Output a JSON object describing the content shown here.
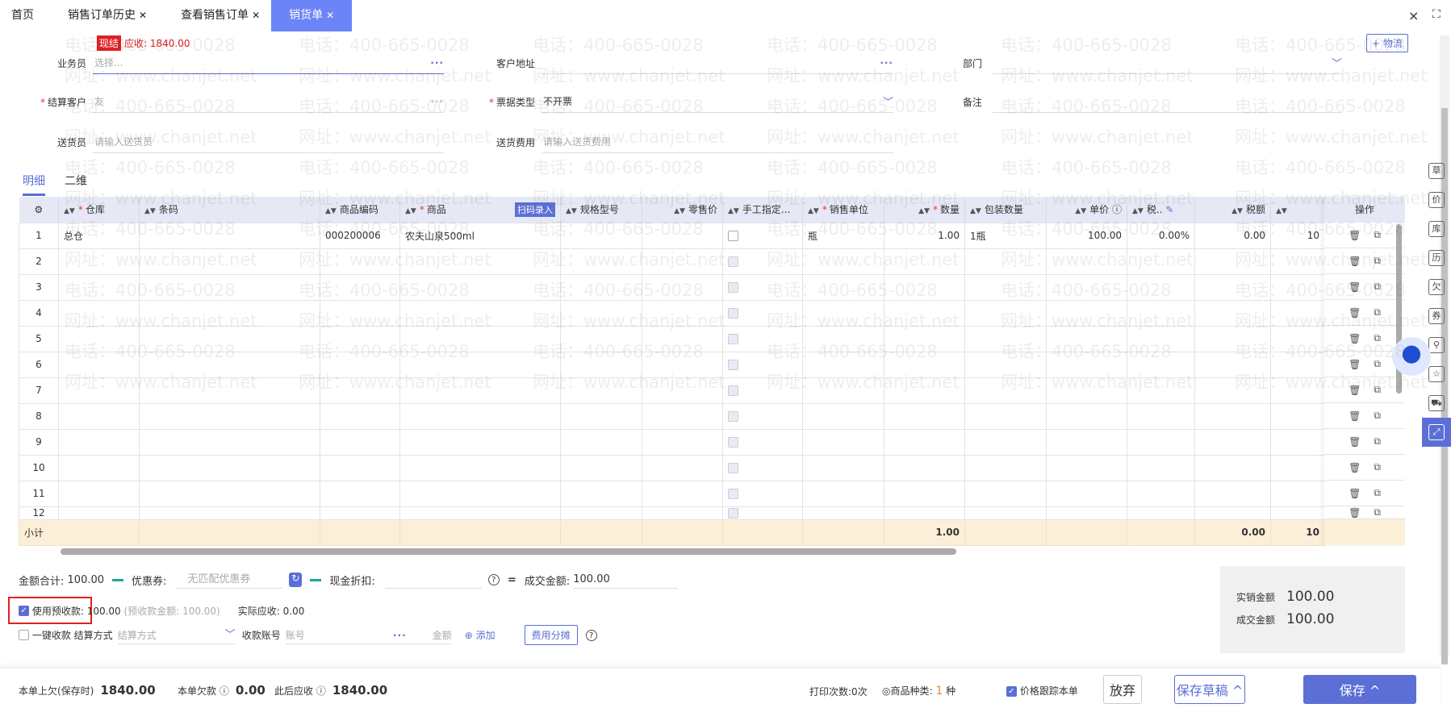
{
  "watermark": {
    "phone": "电话：400-665-0028",
    "site": "网址：www.chanjet.net"
  },
  "tabs": [
    {
      "label": "首页",
      "closable": false
    },
    {
      "label": "销售订单历史",
      "closable": true
    },
    {
      "label": "查看销售订单",
      "closable": true
    },
    {
      "label": "销货单",
      "closable": true,
      "active": true
    }
  ],
  "close_x": "×",
  "header": {
    "badge": "现结",
    "receivable": "应收: 1840.00",
    "logistics_button": "+ 物流",
    "fields": {
      "salesman": {
        "label": "业务员",
        "placeholder": "选择..."
      },
      "customer_address": {
        "label": "客户地址"
      },
      "department": {
        "label": "部门"
      },
      "settle_customer": {
        "label": "结算客户",
        "value": "友"
      },
      "invoice_type": {
        "label": "票据类型",
        "value": "不开票"
      },
      "remark": {
        "label": "备注"
      },
      "deliverer": {
        "label": "送货员",
        "placeholder": "请输入送货员"
      },
      "delivery_fee": {
        "label": "送货费用",
        "placeholder": "请输入送货费用"
      }
    }
  },
  "subtabs": [
    "明细",
    "二维"
  ],
  "table": {
    "columns": [
      "仓库",
      "条码",
      "商品编码",
      "商品",
      "规格型号",
      "零售价",
      "手工指定...",
      "销售单位",
      "数量",
      "包装数量",
      "单价",
      "税..",
      "税额",
      ""
    ],
    "scan_label": "扫码录入",
    "ops_header": "操作",
    "rows": [
      {
        "no": "1",
        "warehouse": "总仓",
        "barcode": "",
        "code": "000200006",
        "product": "农夫山泉500ml",
        "spec": "",
        "retail": "",
        "unit": "瓶",
        "qty": "1.00",
        "pack": "1瓶",
        "price": "100.00",
        "tax_rate": "0.00%",
        "tax": "0.00",
        "amount": "10"
      },
      {
        "no": "2"
      },
      {
        "no": "3"
      },
      {
        "no": "4"
      },
      {
        "no": "5"
      },
      {
        "no": "6"
      },
      {
        "no": "7"
      },
      {
        "no": "8"
      },
      {
        "no": "9"
      },
      {
        "no": "10"
      },
      {
        "no": "11"
      },
      {
        "no": "12"
      }
    ],
    "subtotal": {
      "label": "小计",
      "qty": "1.00",
      "tax": "0.00",
      "amount": "10"
    }
  },
  "summary": {
    "total_label": "金额合计:",
    "total": "100.00",
    "coupon_label": "优惠券:",
    "coupon_value": "无匹配优惠券",
    "cash_discount_label": "现金折扣:",
    "deal_label": "成交金额:",
    "deal": "100.00",
    "use_prepay_label": "使用预收款:",
    "use_prepay": "100.00",
    "prepay_note": "(预收款金额: 100.00)",
    "actual_label": "实际应收:",
    "actual": "0.00",
    "one_click_label": "一键收款",
    "settle_method_label": "结算方式",
    "settle_method_ph": "结算方式",
    "account_label": "收款账号",
    "account_ph": "账号",
    "amount_label": "金额",
    "add_label": "添加",
    "fee_split": "费用分摊"
  },
  "totals_box": {
    "real_sales_label": "实销金额",
    "real_sales": "100.00",
    "deal_label": "成交金额",
    "deal": "100.00"
  },
  "footer": {
    "prev_owe_label": "本单上欠(保存时)",
    "prev_owe": "1840.00",
    "owe_label": "本单欠款",
    "owe": "0.00",
    "after_label": "此后应收",
    "after": "1840.00",
    "print_count": "打印次数:0次",
    "kinds_label": "商品种类:",
    "kinds": "1",
    "kinds_unit": "种",
    "price_track": "价格跟踪本单",
    "discard": "放弃",
    "save_draft": "保存草稿 ^",
    "save": "保存 ^"
  },
  "sidebar": [
    "草",
    "价",
    "库",
    "历",
    "欠",
    "券",
    "⚲",
    "☆",
    "⛟",
    "⤢"
  ],
  "colors": {
    "accent": "#5b6fd6",
    "red": "#e02020"
  }
}
